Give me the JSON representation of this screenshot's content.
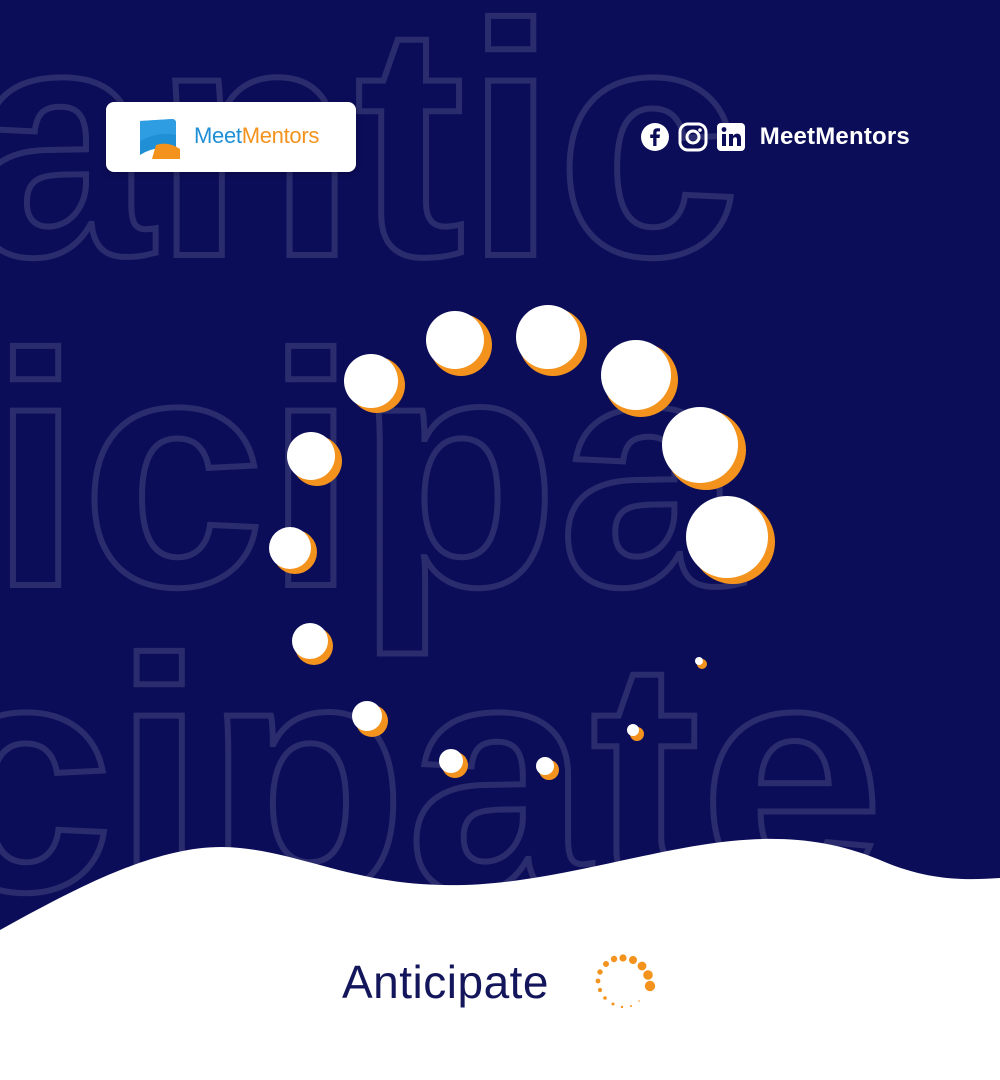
{
  "brand": {
    "logo_meet": "Meet",
    "logo_mentors": "Mentors"
  },
  "social": {
    "icons": [
      "facebook-icon",
      "instagram-icon",
      "linkedin-icon"
    ],
    "handle": "MeetMentors"
  },
  "background_word": "anticipate",
  "footer": {
    "word": "Anticipate"
  },
  "colors": {
    "background": "#0c0d59",
    "outline_text": "#2a2c6e",
    "dot": "#ffffff",
    "dot_shadow": "#f3931e",
    "footer_text": "#14165b",
    "accent_blue": "#1f8fd6",
    "accent_orange": "#f3931e"
  }
}
